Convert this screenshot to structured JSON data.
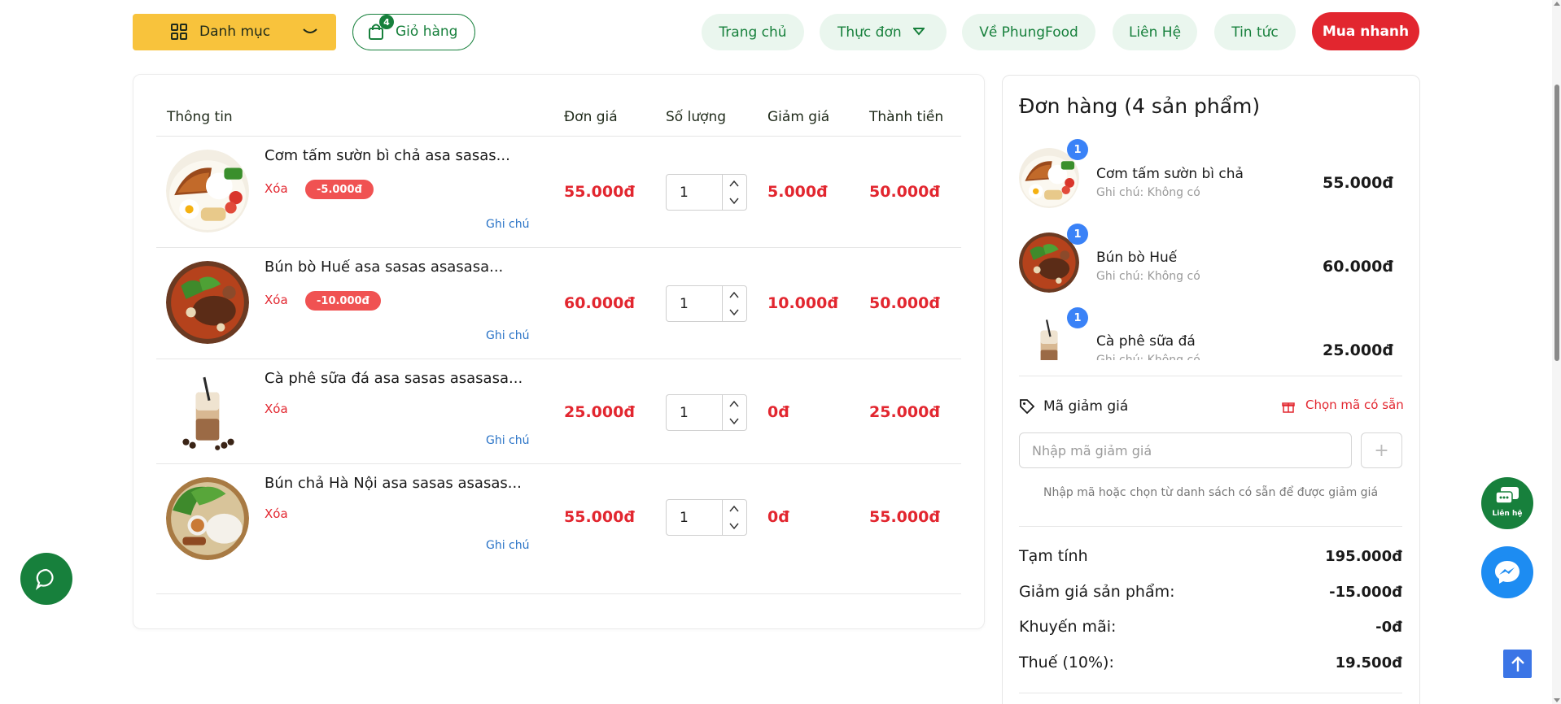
{
  "header": {
    "category_label": "Danh mục",
    "cart_label": "Giỏ hàng",
    "cart_count": "4",
    "nav": {
      "home": "Trang chủ",
      "menu": "Thực đơn",
      "about": "Về PhungFood",
      "contact": "Liên Hệ",
      "news": "Tin tức",
      "buy_now": "Mua nhanh"
    }
  },
  "cart": {
    "columns": {
      "info": "Thông tin",
      "unit_price": "Đơn giá",
      "quantity": "Số lượng",
      "discount": "Giảm giá",
      "total": "Thành tiền"
    },
    "delete_label": "Xóa",
    "note_label": "Ghi chú",
    "items": [
      {
        "name": "Cơm tấm sườn bì chả asa sasas...",
        "discount_badge": "-5.000đ",
        "unit_price": "55.000đ",
        "quantity": "1",
        "discount": "5.000đ",
        "total": "50.000đ",
        "image": "com-tam"
      },
      {
        "name": "Bún bò Huế asa sasas asasasa...",
        "discount_badge": "-10.000đ",
        "unit_price": "60.000đ",
        "quantity": "1",
        "discount": "10.000đ",
        "total": "50.000đ",
        "image": "bun-bo"
      },
      {
        "name": "Cà phê sữa đá asa sasas asasasa...",
        "discount_badge": "",
        "unit_price": "25.000đ",
        "quantity": "1",
        "discount": "0đ",
        "total": "25.000đ",
        "image": "ca-phe"
      },
      {
        "name": "Bún chả Hà Nội asa sasas asasas...",
        "discount_badge": "",
        "unit_price": "55.000đ",
        "quantity": "1",
        "discount": "0đ",
        "total": "55.000đ",
        "image": "bun-cha"
      }
    ]
  },
  "order": {
    "title": "Đơn hàng (4 sản phẩm)",
    "items": [
      {
        "count": "1",
        "name": "Cơm tấm sườn bì chả",
        "note": "Ghi chú: Không có",
        "price": "55.000đ"
      },
      {
        "count": "1",
        "name": "Bún bò Huế",
        "note": "Ghi chú: Không có",
        "price": "60.000đ"
      },
      {
        "count": "1",
        "name": "Cà phê sữa đá",
        "note": "Ghi chú: Không có",
        "price": "25.000đ"
      }
    ],
    "coupon": {
      "label": "Mã giảm giá",
      "pick_label": "Chọn mã có sẵn",
      "placeholder": "Nhập mã giảm giá",
      "add_symbol": "+",
      "hint": "Nhập mã hoặc chọn từ danh sách có sẵn để được giảm giá"
    },
    "summary": {
      "subtotal_label": "Tạm tính",
      "subtotal": "195.000đ",
      "product_discount_label": "Giảm giá sản phẩm:",
      "product_discount": "-15.000đ",
      "promotion_label": "Khuyến mãi:",
      "promotion": "-0đ",
      "tax_label": "Thuế (10%):",
      "tax": "19.500đ"
    }
  },
  "floating": {
    "contact_label": "Liên hệ"
  },
  "colors": {
    "brand_green": "#17803c",
    "accent_yellow": "#f8c33c",
    "price_red": "#e2262f",
    "badge_blue": "#3a82f7"
  }
}
